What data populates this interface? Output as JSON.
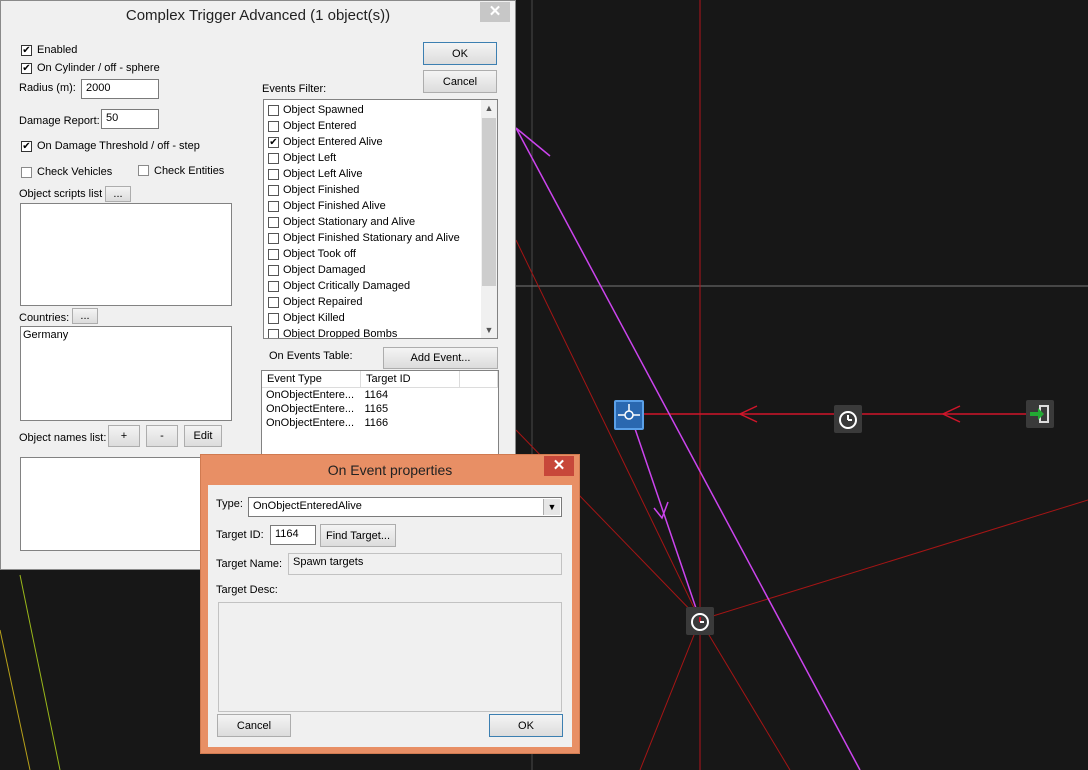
{
  "main_dialog": {
    "title": "Complex Trigger Advanced (1 object(s))",
    "close_glyph": "✕",
    "enabled_label": "Enabled",
    "enabled_checked": true,
    "cylinder_label": "On Cylinder / off - sphere",
    "cylinder_checked": true,
    "radius_label": "Radius (m):",
    "radius_value": "2000",
    "damage_report_label": "Damage Report:",
    "damage_report_value": "50",
    "damage_threshold_label": "On Damage Threshold / off - step",
    "damage_threshold_checked": true,
    "check_vehicles_label": "Check Vehicles",
    "check_vehicles_checked": false,
    "check_entities_label": "Check Entities",
    "check_entities_checked": false,
    "scripts_label": "Object scripts list",
    "ellipsis_label": "...",
    "countries_label": "Countries:",
    "countries": [
      "Germany"
    ],
    "names_label": "Object names list:",
    "plus_label": "+",
    "minus_label": "-",
    "edit_label": "Edit",
    "ok_label": "OK",
    "cancel_label": "Cancel",
    "events_filter_label": "Events Filter:",
    "events_filter": [
      {
        "label": "Object Spawned",
        "checked": false
      },
      {
        "label": "Object Entered",
        "checked": false
      },
      {
        "label": "Object Entered Alive",
        "checked": true
      },
      {
        "label": "Object Left",
        "checked": false
      },
      {
        "label": "Object Left Alive",
        "checked": false
      },
      {
        "label": "Object Finished",
        "checked": false
      },
      {
        "label": "Object Finished Alive",
        "checked": false
      },
      {
        "label": "Object Stationary and Alive",
        "checked": false
      },
      {
        "label": "Object Finished Stationary and Alive",
        "checked": false
      },
      {
        "label": "Object Took off",
        "checked": false
      },
      {
        "label": "Object Damaged",
        "checked": false
      },
      {
        "label": "Object Critically Damaged",
        "checked": false
      },
      {
        "label": "Object Repaired",
        "checked": false
      },
      {
        "label": "Object Killed",
        "checked": false
      },
      {
        "label": "Object Dropped Bombs",
        "checked": false
      }
    ],
    "events_table_label": "On Events Table:",
    "add_event_label": "Add Event...",
    "table_headers": [
      "Event Type",
      "Target ID"
    ],
    "table_rows": [
      [
        "OnObjectEntere...",
        "1164"
      ],
      [
        "OnObjectEntere...",
        "1165"
      ],
      [
        "OnObjectEntere...",
        "1166"
      ]
    ]
  },
  "event_dialog": {
    "title": "On Event properties",
    "close_glyph": "✕",
    "type_label": "Type:",
    "type_value": "OnObjectEnteredAlive",
    "target_id_label": "Target ID:",
    "target_id_value": "1164",
    "find_target_label": "Find Target...",
    "target_name_label": "Target Name:",
    "target_name_value": "Spawn targets",
    "target_desc_label": "Target Desc:",
    "cancel_label": "Cancel",
    "ok_label": "OK"
  },
  "colors": {
    "accent_orange": "#e88f65",
    "close_red": "#c7c7c7",
    "link_red": "#c8102e",
    "link_magenta": "#cc44ee"
  }
}
